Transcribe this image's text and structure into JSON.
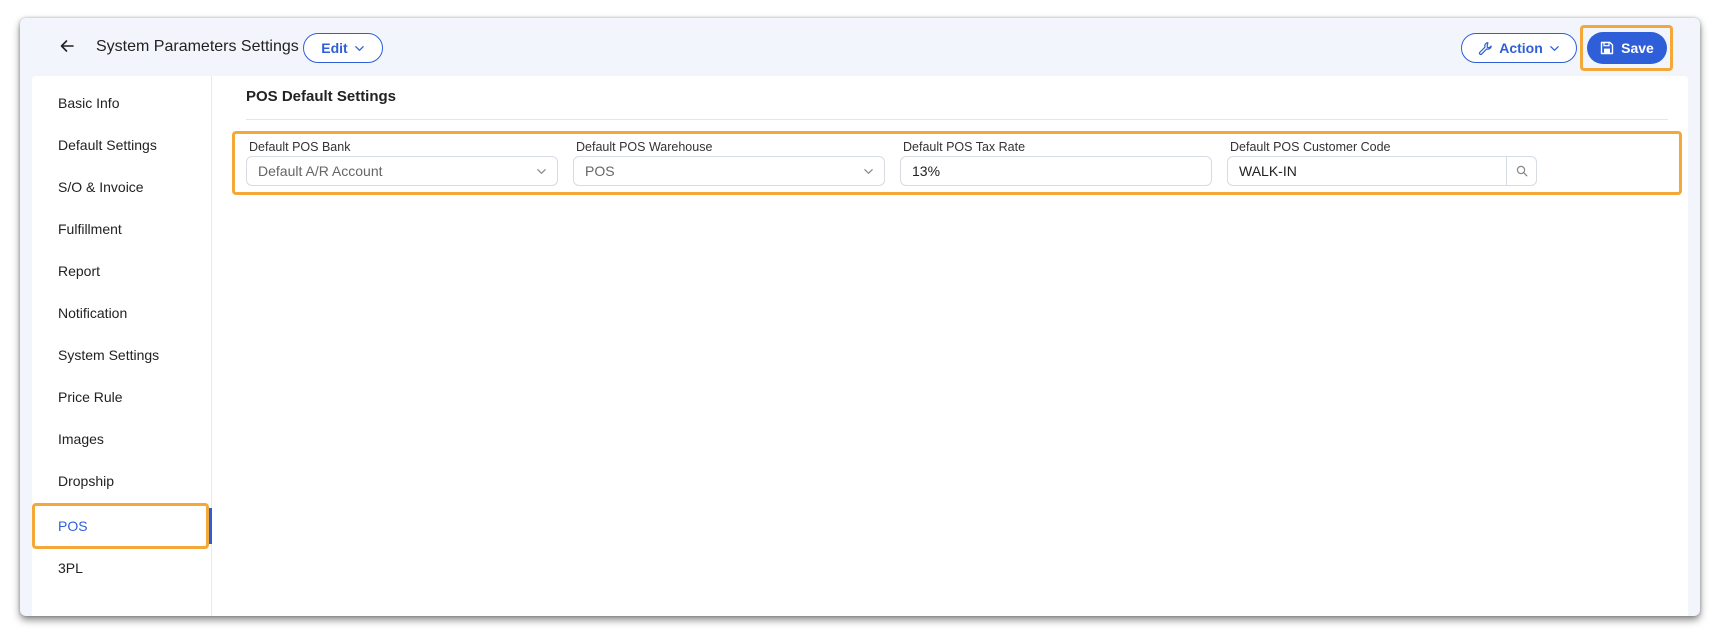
{
  "header": {
    "title": "System Parameters Settings",
    "edit_label": "Edit",
    "action_label": "Action",
    "save_label": "Save"
  },
  "sidebar": {
    "items": [
      {
        "label": "Basic Info"
      },
      {
        "label": "Default Settings"
      },
      {
        "label": "S/O & Invoice"
      },
      {
        "label": "Fulfillment"
      },
      {
        "label": "Report"
      },
      {
        "label": "Notification"
      },
      {
        "label": "System Settings"
      },
      {
        "label": "Price Rule"
      },
      {
        "label": "Images"
      },
      {
        "label": "Dropship"
      },
      {
        "label": "POS"
      },
      {
        "label": "3PL"
      }
    ],
    "active": "POS"
  },
  "section": {
    "title": "POS Default Settings",
    "fields": [
      {
        "label": "Default POS Bank",
        "value": "Default A/R Account"
      },
      {
        "label": "Default POS Warehouse",
        "value": "POS"
      },
      {
        "label": "Default POS Tax Rate",
        "value": "13%"
      },
      {
        "label": "Default POS Customer Code",
        "value": "WALK-IN"
      }
    ]
  },
  "colors": {
    "accent": "#2f5fd8",
    "highlight": "#f5a83a",
    "window_bg": "#f2f5fb"
  },
  "icons": [
    "arrow-left-icon",
    "chevron-down-icon",
    "wrench-icon",
    "save-icon",
    "search-icon"
  ]
}
